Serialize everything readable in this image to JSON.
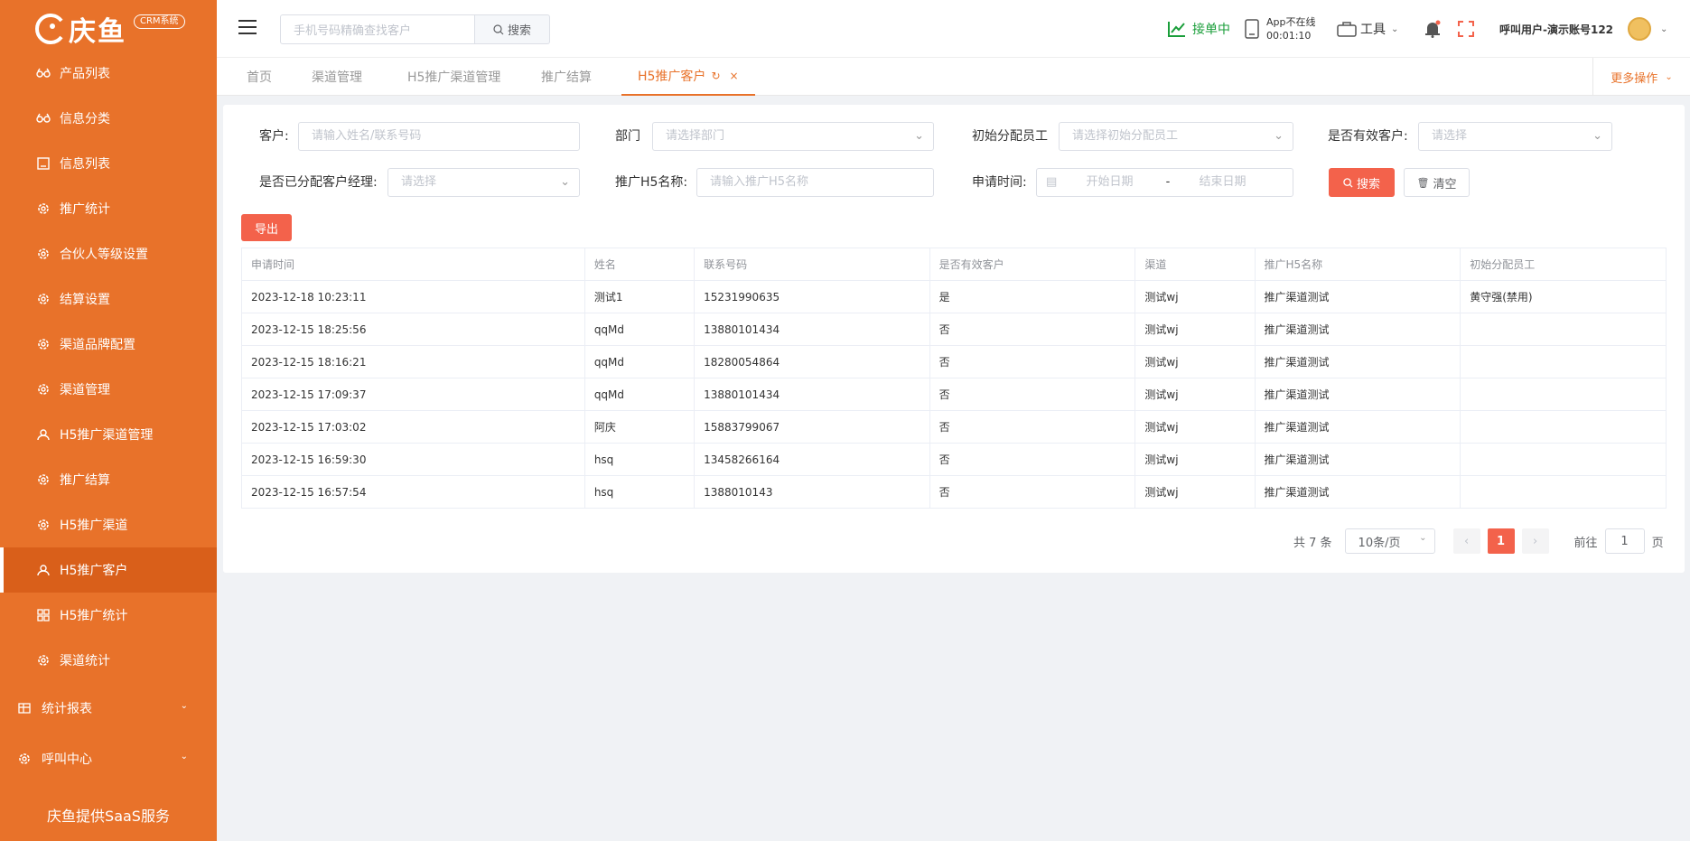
{
  "brand": {
    "name": "庆鱼",
    "badge": "CRM系统",
    "footer": "庆鱼提供SaaS服务",
    "accent": "#e8722a"
  },
  "sidebar": {
    "items": [
      {
        "label": "产品列表",
        "icon": "glasses-icon"
      },
      {
        "label": "信息分类",
        "icon": "glasses-icon"
      },
      {
        "label": "信息列表",
        "icon": "book-icon"
      },
      {
        "label": "推广统计",
        "icon": "gear-icon"
      },
      {
        "label": "合伙人等级设置",
        "icon": "gear-icon"
      },
      {
        "label": "结算设置",
        "icon": "gear-icon"
      },
      {
        "label": "渠道品牌配置",
        "icon": "gear-icon"
      },
      {
        "label": "渠道管理",
        "icon": "gear-icon"
      },
      {
        "label": "H5推广渠道管理",
        "icon": "user-icon"
      },
      {
        "label": "推广结算",
        "icon": "gear-icon"
      },
      {
        "label": "H5推广渠道",
        "icon": "gear-icon"
      },
      {
        "label": "H5推广客户",
        "icon": "user-icon",
        "active": true
      },
      {
        "label": "H5推广统计",
        "icon": "grid-icon"
      },
      {
        "label": "渠道统计",
        "icon": "gear-icon"
      }
    ],
    "groups": [
      {
        "label": "统计报表",
        "icon": "table-icon"
      },
      {
        "label": "呼叫中心",
        "icon": "gear-icon"
      }
    ]
  },
  "topbar": {
    "search_placeholder": "手机号码精确查找客户",
    "search_button": "搜索",
    "status_label": "接单中",
    "app_status_line1": "App不在线",
    "app_status_line2": "00:01:10",
    "tools_label": "工具",
    "user_label": "呼叫用户-演示账号122"
  },
  "tabs": [
    {
      "label": "首页"
    },
    {
      "label": "渠道管理"
    },
    {
      "label": "H5推广渠道管理"
    },
    {
      "label": "推广结算"
    },
    {
      "label": "H5推广客户",
      "active": true
    }
  ],
  "more_ops": "更多操作",
  "filters": {
    "customer_label": "客户:",
    "customer_placeholder": "请输入姓名/联系号码",
    "dept_label": "部门",
    "dept_placeholder": "请选择部门",
    "init_staff_label": "初始分配员工",
    "init_staff_placeholder": "请选择初始分配员工",
    "valid_label": "是否有效客户:",
    "valid_placeholder": "请选择",
    "assigned_label": "是否已分配客户经理:",
    "assigned_placeholder": "请选择",
    "h5name_label": "推广H5名称:",
    "h5name_placeholder": "请输入推广H5名称",
    "apply_time_label": "申请时间:",
    "start_date": "开始日期",
    "date_sep": "-",
    "end_date": "结束日期",
    "search_btn": "搜索",
    "clear_btn": "清空",
    "export_btn": "导出"
  },
  "table": {
    "columns": [
      "申请时间",
      "姓名",
      "联系号码",
      "是否有效客户",
      "渠道",
      "推广H5名称",
      "初始分配员工"
    ],
    "rows": [
      [
        "2023-12-18 10:23:11",
        "测试1",
        "15231990635",
        "是",
        "测试wj",
        "推广渠道测试",
        "黄守强(禁用)"
      ],
      [
        "2023-12-15 18:25:56",
        "qqMd",
        "13880101434",
        "否",
        "测试wj",
        "推广渠道测试",
        ""
      ],
      [
        "2023-12-15 18:16:21",
        "qqMd",
        "18280054864",
        "否",
        "测试wj",
        "推广渠道测试",
        ""
      ],
      [
        "2023-12-15 17:09:37",
        "qqMd",
        "13880101434",
        "否",
        "测试wj",
        "推广渠道测试",
        ""
      ],
      [
        "2023-12-15 17:03:02",
        "阿庆",
        "15883799067",
        "否",
        "测试wj",
        "推广渠道测试",
        ""
      ],
      [
        "2023-12-15 16:59:30",
        "hsq",
        "13458266164",
        "否",
        "测试wj",
        "推广渠道测试",
        ""
      ],
      [
        "2023-12-15 16:57:54",
        "hsq",
        "1388010143",
        "否",
        "测试wj",
        "推广渠道测试",
        ""
      ]
    ]
  },
  "pagination": {
    "total": "共 7 条",
    "page_size": "10条/页",
    "current": "1",
    "goto_prefix": "前往",
    "goto_value": "1",
    "goto_suffix": "页"
  }
}
